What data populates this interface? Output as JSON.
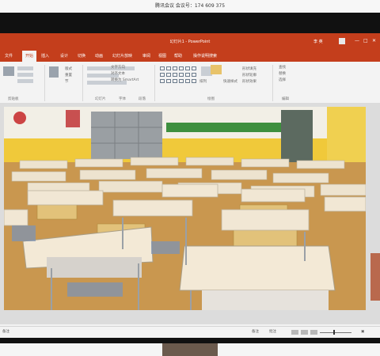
{
  "meeting": {
    "text": "腾讯会议 会议号：174 609 375"
  },
  "window": {
    "title": "幻灯片1 - PowerPoint",
    "user": "李 英",
    "controls": [
      "—",
      "□",
      "✕"
    ]
  },
  "tabs": [
    "文件",
    "开始",
    "插入",
    "设计",
    "切换",
    "动画",
    "幻灯片放映",
    "审阅",
    "视图",
    "帮助",
    "操作说明搜索"
  ],
  "ribbon": {
    "groups": [
      "剪贴板",
      "幻灯片",
      "字体",
      "段落",
      "绘图",
      "编辑"
    ],
    "slides_items": [
      "版式",
      "重置",
      "节"
    ],
    "paragraph_items": [
      "文字方向",
      "对齐文本",
      "转换为 SmartArt"
    ],
    "drawing_items": [
      "排列",
      "快速样式",
      "形状填充",
      "形状轮廓",
      "形状效果"
    ],
    "editing_items": [
      "查找",
      "替换",
      "选择"
    ]
  },
  "statusbar": {
    "left": "备注",
    "items": [
      "备注",
      "批注"
    ]
  },
  "colors": {
    "ppt_red": "#c43e1c",
    "ribbon_bg": "#f3f3f3",
    "floor": "#c9974f",
    "wall": "#f2efe6",
    "wall_yellow": "#f0c93a"
  },
  "slide_image": "classroom-desks-photo"
}
